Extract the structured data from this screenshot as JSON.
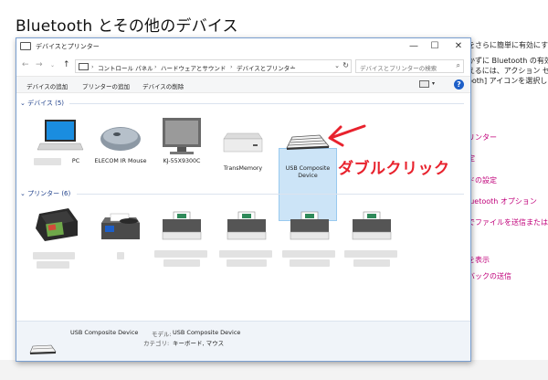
{
  "background": {
    "title": "Bluetooth とその他のデバイス",
    "right_texts": [
      "をさらに簡単に有効にする",
      "かずに Bluetooth の有効",
      "えるには、アクション センタ",
      "ooth] アイコンを選択しま"
    ],
    "right_links": [
      "リンター",
      "定",
      "ドの設定",
      "luetooth オプション",
      "でファイルを送信または受",
      "を表示",
      "バックの送信"
    ]
  },
  "window": {
    "title": "デバイスとプリンター",
    "controls": {
      "minimize": "—",
      "maximize": "☐",
      "close": "✕"
    },
    "address": {
      "crumbs": [
        "コントロール パネル",
        "ハードウェアとサウンド",
        "デバイスとプリンター"
      ],
      "separator": "›"
    },
    "search_placeholder": "デバイスとプリンターの検索",
    "commands": [
      "デバイスの追加",
      "プリンターの追加",
      "デバイスの削除"
    ]
  },
  "groups": {
    "devices": {
      "header": "デバイス (5)",
      "items": [
        {
          "label": "PC",
          "icon": "laptop-icon"
        },
        {
          "label": "ELECOM IR Mouse",
          "icon": "mouse-icon"
        },
        {
          "label": "KJ-55X9300C",
          "icon": "monitor-icon"
        },
        {
          "label": "TransMemory",
          "icon": "drive-icon"
        },
        {
          "label": "USB Composite Device",
          "icon": "keyboard-icon"
        }
      ]
    },
    "printers": {
      "header": "プリンター (6)",
      "items": [
        {
          "icon": "inkjet-printer-icon"
        },
        {
          "icon": "fax-icon"
        },
        {
          "icon": "printer-icon"
        },
        {
          "icon": "printer-icon"
        },
        {
          "icon": "printer-icon"
        },
        {
          "icon": "printer-icon"
        }
      ]
    }
  },
  "details": {
    "name": "USB Composite Device",
    "model_label": "モデル:",
    "model_value": "USB Composite Device",
    "category_label": "カテゴリ:",
    "category_value": "キーボード, マウス"
  },
  "annotation": {
    "text": "ダブルクリック",
    "color": "#e8222d"
  }
}
